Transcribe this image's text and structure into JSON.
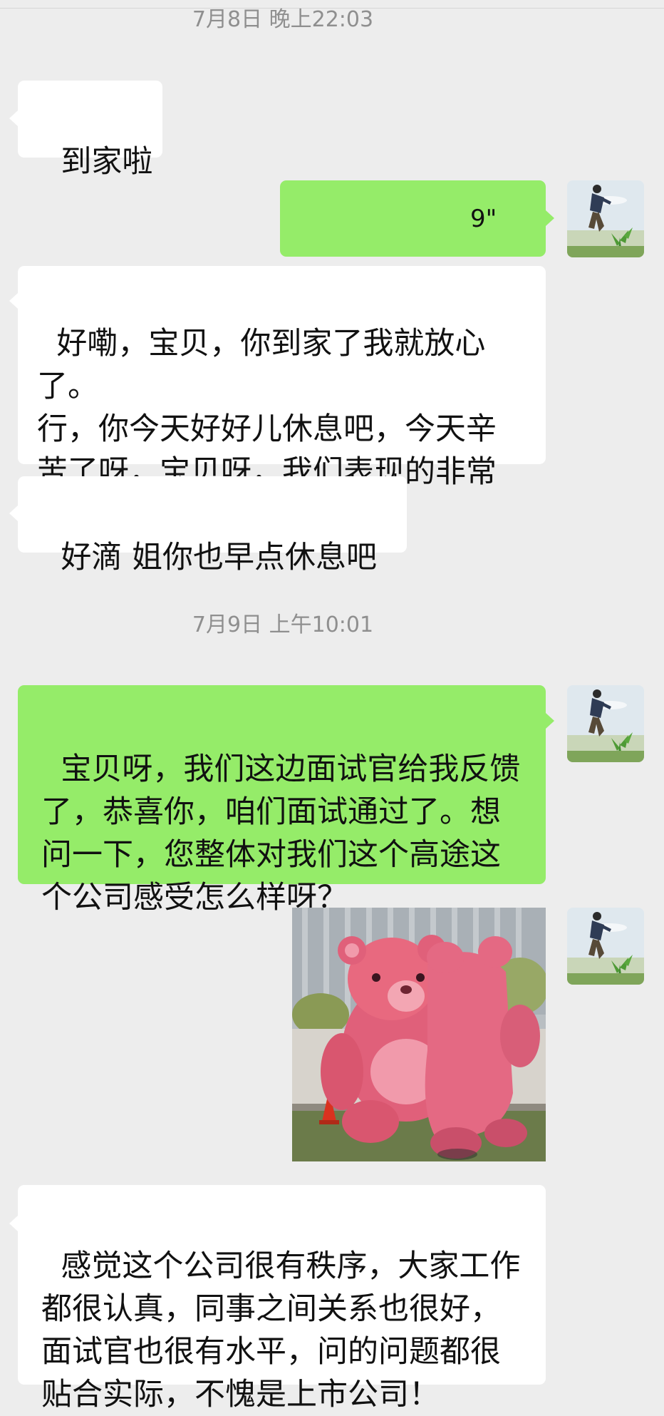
{
  "chat": {
    "timestamps": {
      "t1": "7月8日 晚上22:03",
      "t2": "7月9日 上午10:01"
    },
    "messages": {
      "m1": "到家啦",
      "m2_voice_duration": "9\"",
      "m3": "好嘞，宝贝，你到家了我就放心了。\n行，你今天好好儿休息吧，今天辛\n苦了呀，宝贝呀，我们表现的非常\n棒。",
      "m4": "好滴 姐你也早点休息吧",
      "m5": "宝贝呀，我们这边面试官给我反馈\n了，恭喜你，咱们面试通过了。想\n问一下，您整体对我们这个高途这\n个公司感受怎么样呀？",
      "m7": "感觉这个公司很有秩序，大家工作\n都很认真，同事之间关系也很好，\n面试官也很有水平，问的问题都很\n贴合实际，不愧是上市公司！"
    },
    "icons": {
      "voice": "voice-wave-icon",
      "avatar": "avatar-photo",
      "sticker": "pink-bear-sticker"
    },
    "colors": {
      "background": "#ededed",
      "incoming_bubble": "#ffffff",
      "outgoing_bubble": "#95ec69",
      "timestamp_text": "#8f8f8f"
    }
  }
}
